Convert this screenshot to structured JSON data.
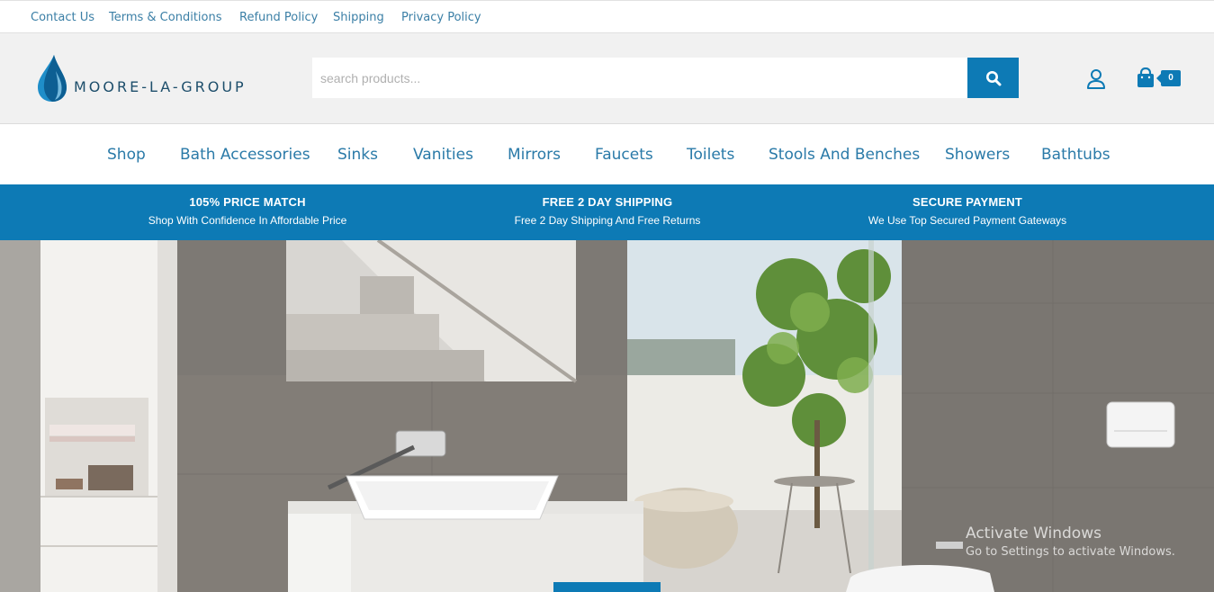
{
  "topbar": {
    "links": [
      "Contact Us",
      "Terms & Conditions",
      "Refund Policy",
      "Shipping",
      "Privacy Policy"
    ]
  },
  "header": {
    "logo_text": "MOORE-LA-GROUP",
    "search_placeholder": "search products...",
    "cart_count": "0"
  },
  "nav": {
    "items": [
      "Shop",
      "Bath Accessories",
      "Sinks",
      "Vanities",
      "Mirrors",
      "Faucets",
      "Toilets",
      "Stools And Benches",
      "Showers",
      "Bathtubs"
    ]
  },
  "promo": [
    {
      "title": "105% PRICE MATCH",
      "subtitle": "Shop With Confidence In Affordable Price"
    },
    {
      "title": "FREE 2 DAY SHIPPING",
      "subtitle": "Free 2 Day Shipping And Free Returns"
    },
    {
      "title": "SECURE PAYMENT",
      "subtitle": "We Use Top Secured Payment Gateways"
    }
  ],
  "watermark": {
    "line1": "Activate Windows",
    "line2": "Go to Settings to activate Windows."
  },
  "colors": {
    "brand_blue": "#0d7ab5",
    "link_blue": "#2a7aa8"
  }
}
